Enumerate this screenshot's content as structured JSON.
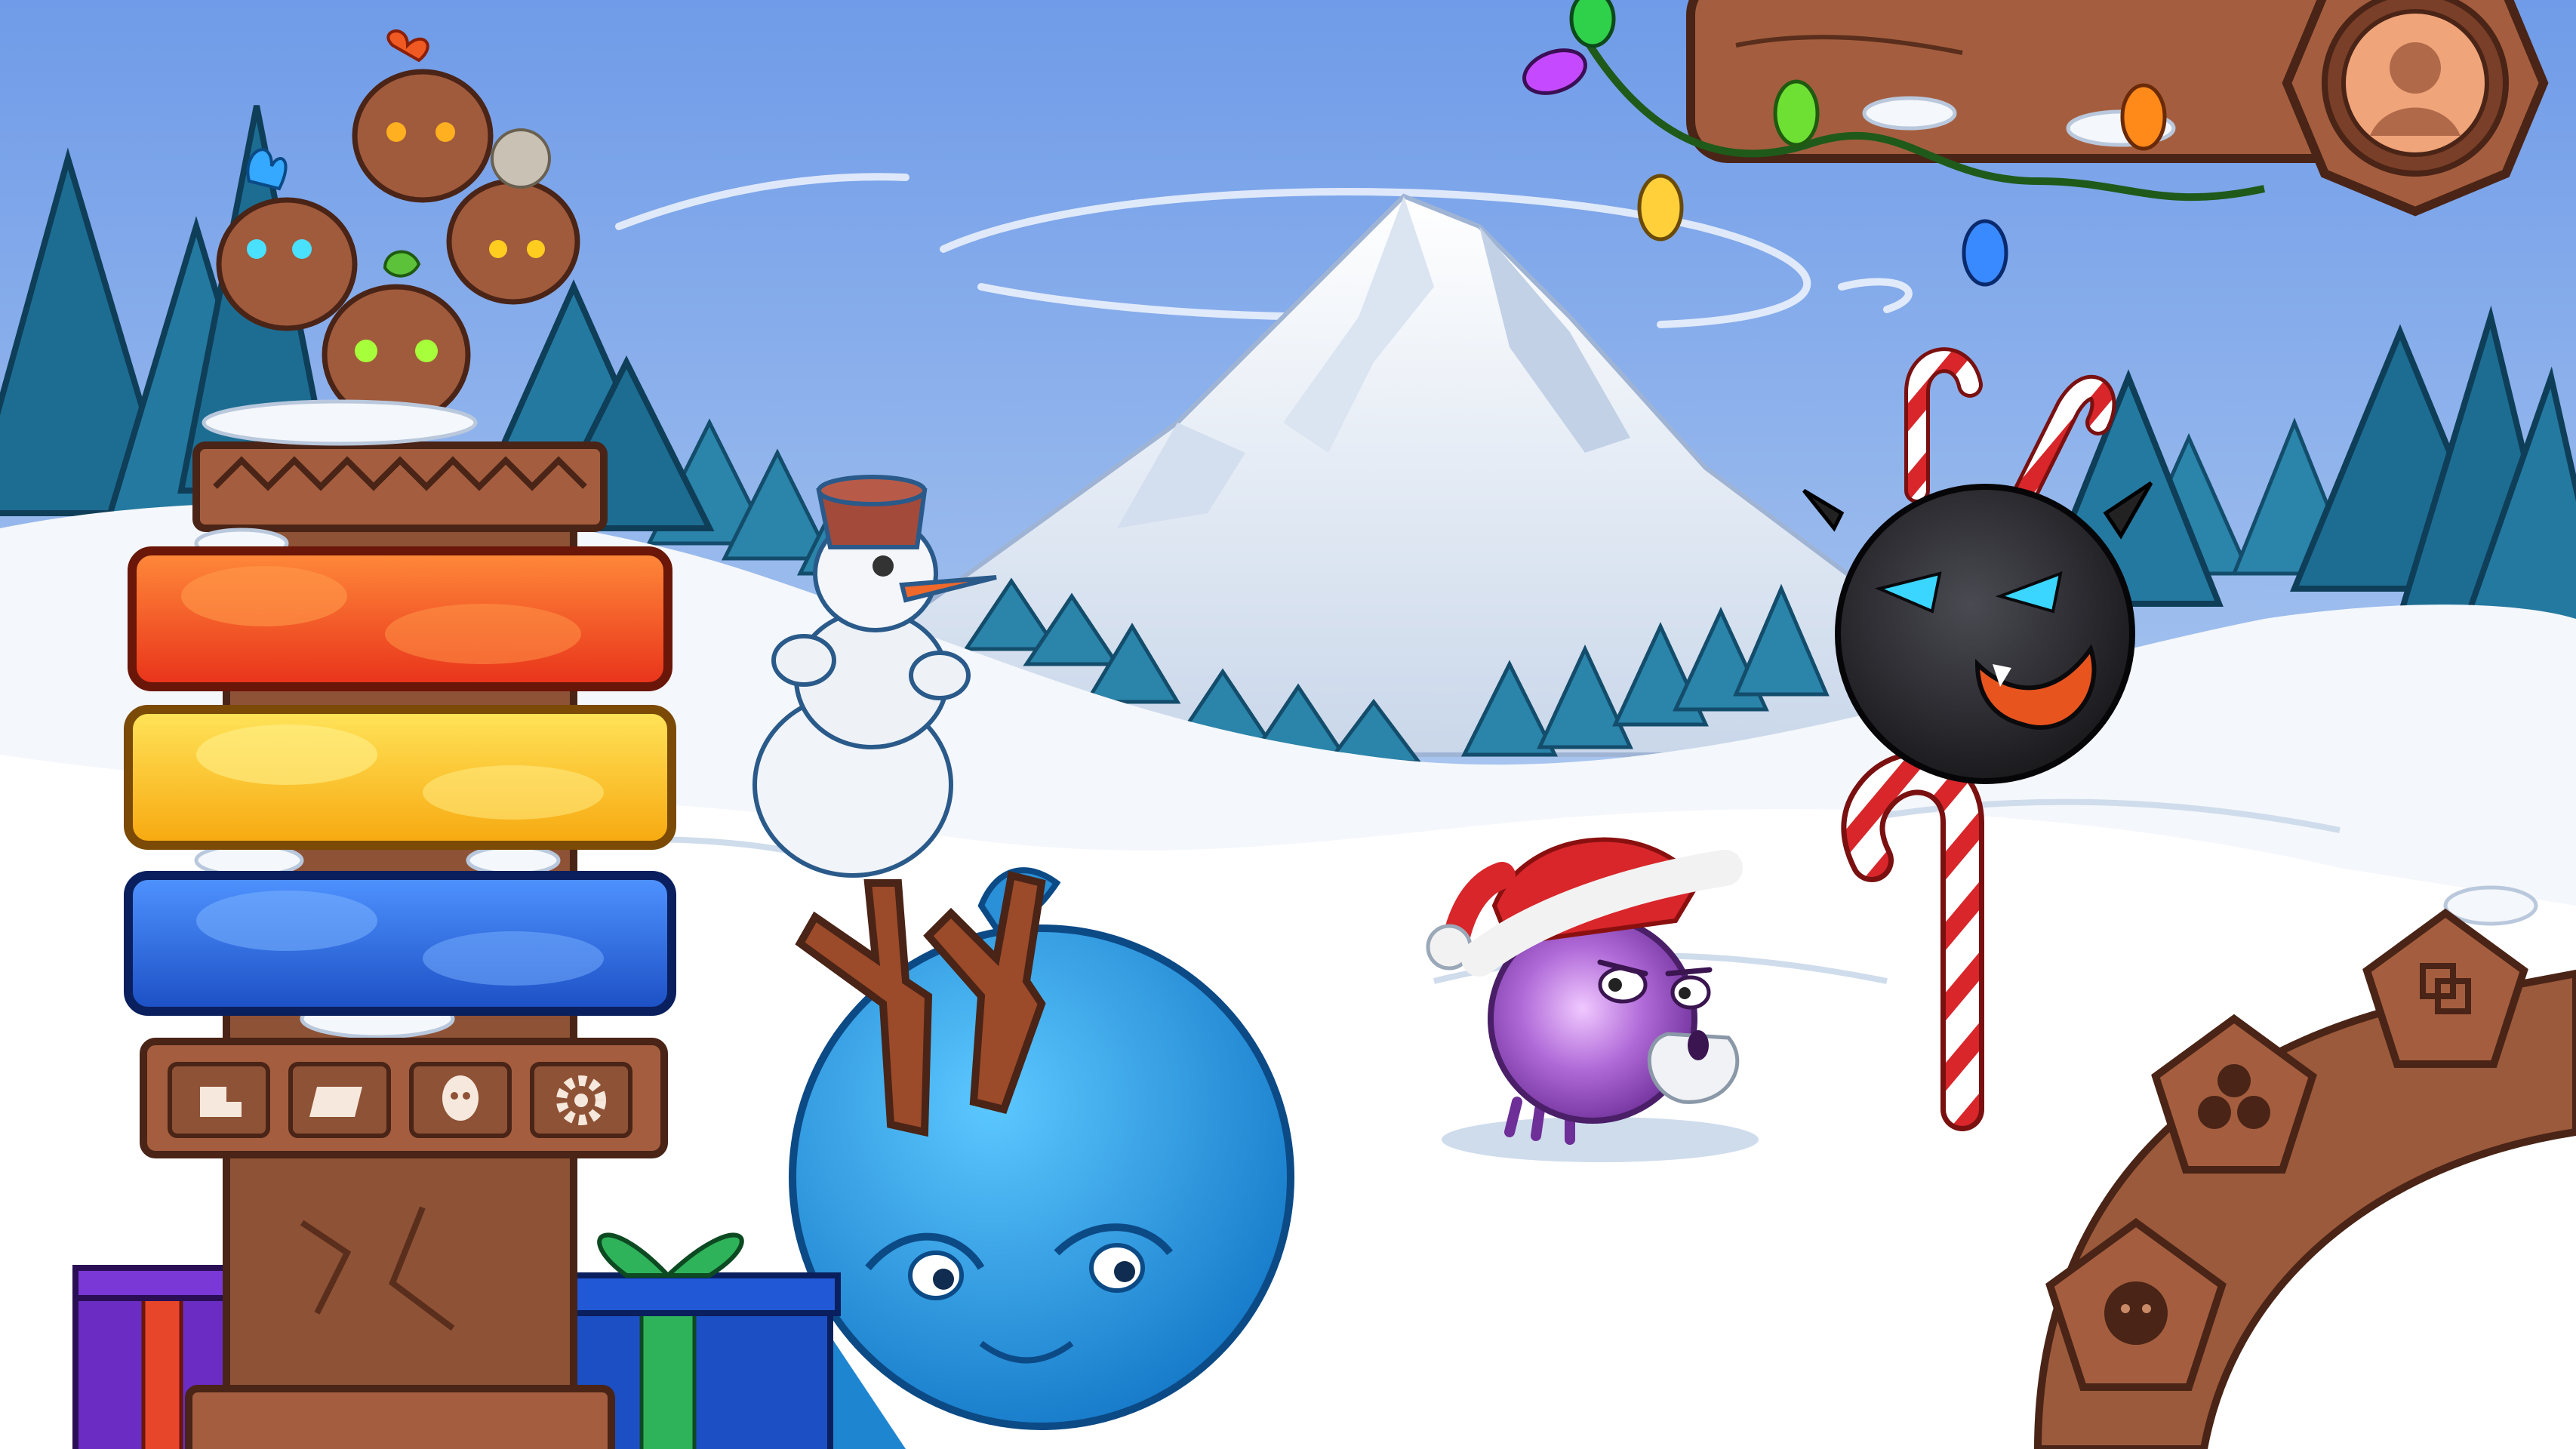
{
  "screen": "winter-main-menu",
  "colors": {
    "sky_top": "#6f9be8",
    "sky_bottom": "#dbe8f7",
    "snow": "#f4f7fb",
    "snow_shadow": "#cfdcec",
    "pine": "#1f6f93",
    "pine_dark": "#14506e",
    "wood": "#9b5a3c",
    "wood_dark": "#5e3322",
    "button_red": "#f05a22",
    "button_yellow": "#ffcb1f",
    "button_blue": "#2f6fe0",
    "blue_blob": "#27a0e6",
    "purple_blob": "#a05cc8",
    "black_blob": "#2a2a2e"
  },
  "menu": {
    "buttons": [
      {
        "id": "red",
        "color": "#f05a22",
        "label": ""
      },
      {
        "id": "yellow",
        "color": "#ffcb1f",
        "label": ""
      },
      {
        "id": "blue",
        "color": "#2f6fe0",
        "label": ""
      }
    ],
    "toolbar_icons": [
      "home-icon",
      "scroll-icon",
      "character-icon",
      "gear-icon"
    ]
  },
  "profile": {
    "avatar_icon": "user-silhouette-icon"
  },
  "map_nodes": [
    {
      "icon": "knot-icon"
    },
    {
      "icon": "three-faces-icon"
    },
    {
      "icon": "face-icon"
    }
  ],
  "gifts": [
    {
      "color": "#6a2cc2",
      "ribbon": "#e7462a"
    },
    {
      "color": "#1c4fc4",
      "ribbon": "#2fb35a"
    }
  ]
}
